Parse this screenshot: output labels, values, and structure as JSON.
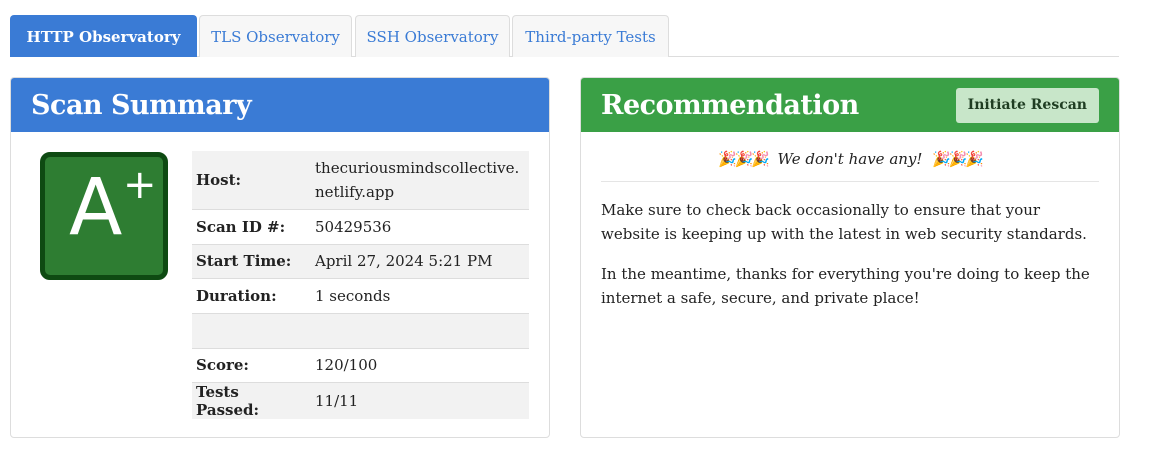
{
  "tabs": [
    {
      "label": "HTTP Observatory",
      "active": true
    },
    {
      "label": "TLS Observatory",
      "active": false
    },
    {
      "label": "SSH Observatory",
      "active": false
    },
    {
      "label": "Third-party Tests",
      "active": false
    }
  ],
  "summary": {
    "title": "Scan Summary",
    "grade": {
      "letter": "A",
      "modifier": "+",
      "color": "#2e7d32"
    },
    "rows": [
      {
        "label": "Host:",
        "value": "thecuriousmindscollective.netlify.app"
      },
      {
        "label": "Scan ID #:",
        "value": "50429536"
      },
      {
        "label": "Start Time:",
        "value": "April 27, 2024 5:21 PM"
      },
      {
        "label": "Duration:",
        "value": "1 seconds"
      },
      {
        "label": "",
        "value": ""
      },
      {
        "label": "Score:",
        "value": "120/100"
      },
      {
        "label": "Tests Passed:",
        "value": "11/11"
      }
    ]
  },
  "recommendation": {
    "title": "Recommendation",
    "rescan_label": "Initiate Rescan",
    "cheer_emoji": "🎉🎉🎉",
    "cheer_text": "We don't have any!",
    "paragraphs": [
      "Make sure to check back occasionally to ensure that your website is keeping up with the latest in web security standards.",
      "In the meantime, thanks for everything you're doing to keep the internet a safe, secure, and private place!"
    ]
  },
  "colors": {
    "primary": "#3a7bd5",
    "success": "#3aa046",
    "grade_border": "#0e4a12"
  }
}
